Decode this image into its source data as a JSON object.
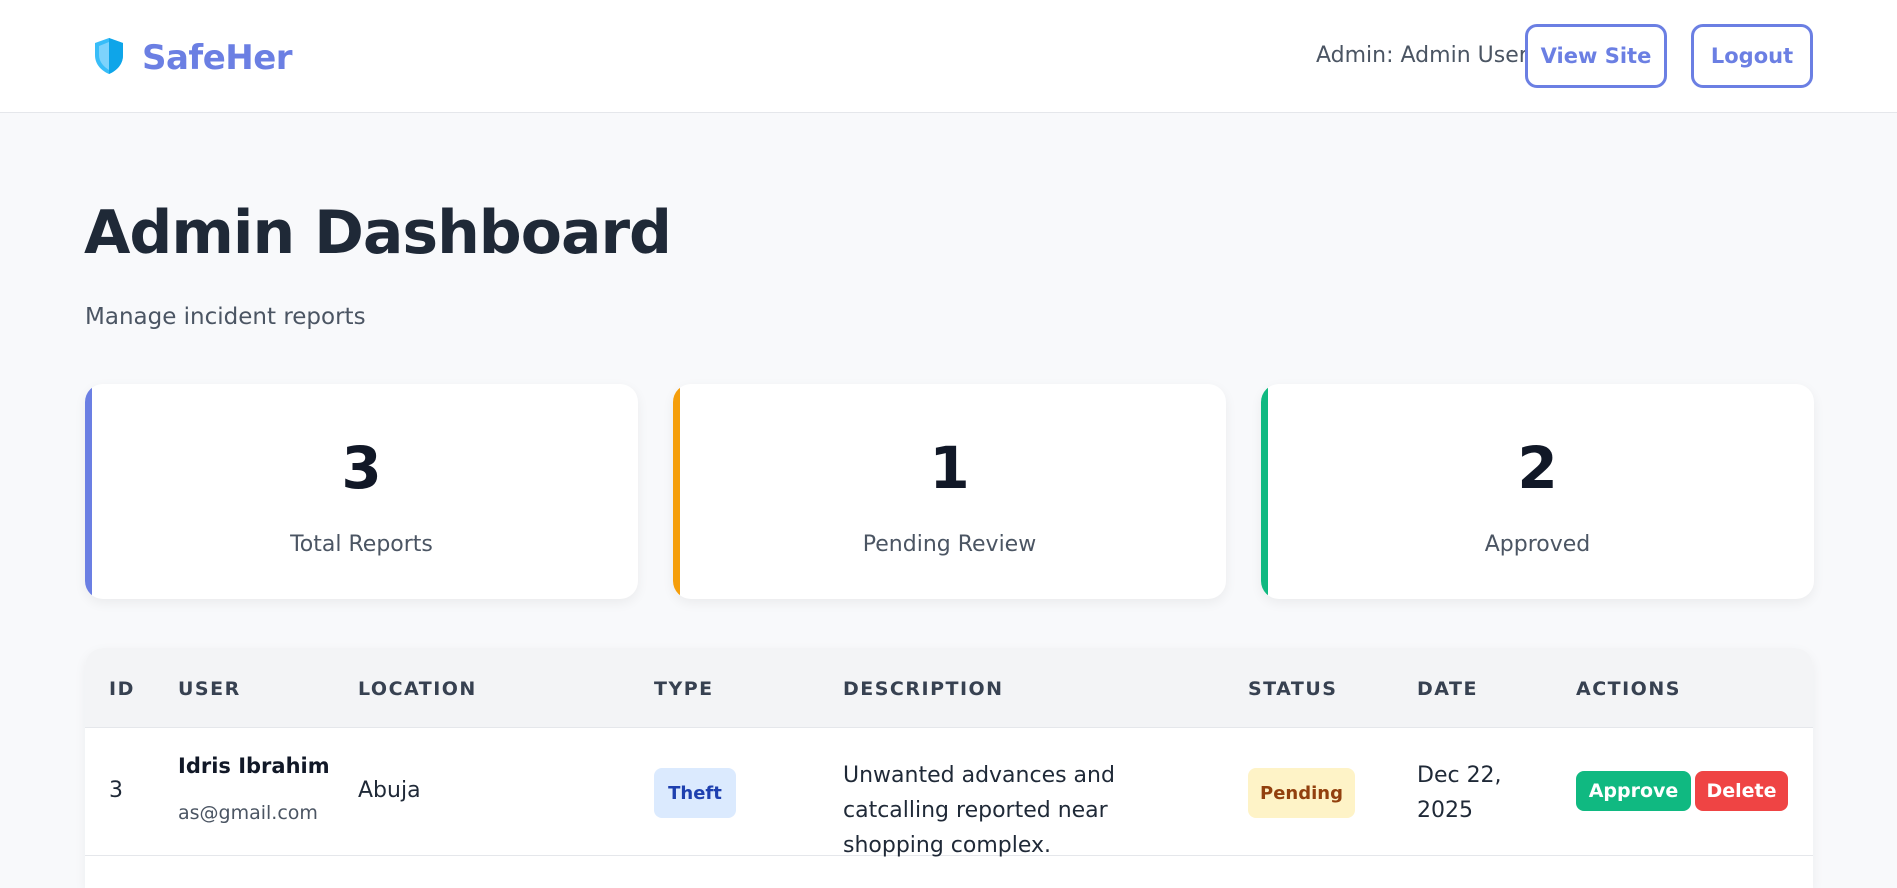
{
  "header": {
    "brand": "SafeHer",
    "admin_label": "Admin: Admin User",
    "view_site_label": "View Site",
    "logout_label": "Logout",
    "brand_icon": "shield-icon",
    "brand_color": "#6b7fe3"
  },
  "page": {
    "title": "Admin Dashboard",
    "subtitle": "Manage incident reports"
  },
  "stats": [
    {
      "value": "3",
      "label": "Total Reports",
      "accent": "#6b7fe3"
    },
    {
      "value": "1",
      "label": "Pending Review",
      "accent": "#f59e0b"
    },
    {
      "value": "2",
      "label": "Approved",
      "accent": "#10b981"
    }
  ],
  "table": {
    "columns": [
      "ID",
      "USER",
      "LOCATION",
      "TYPE",
      "DESCRIPTION",
      "STATUS",
      "DATE",
      "ACTIONS"
    ],
    "rows": [
      {
        "id": "3",
        "user_name": "Idris Ibrahim",
        "user_email": "as@gmail.com",
        "location": "Abuja",
        "type": "Theft",
        "description": "Unwanted advances and catcalling reported near shopping complex.",
        "status": "Pending",
        "date": "Dec 22, 2025",
        "approve_label": "Approve",
        "delete_label": "Delete"
      }
    ]
  }
}
